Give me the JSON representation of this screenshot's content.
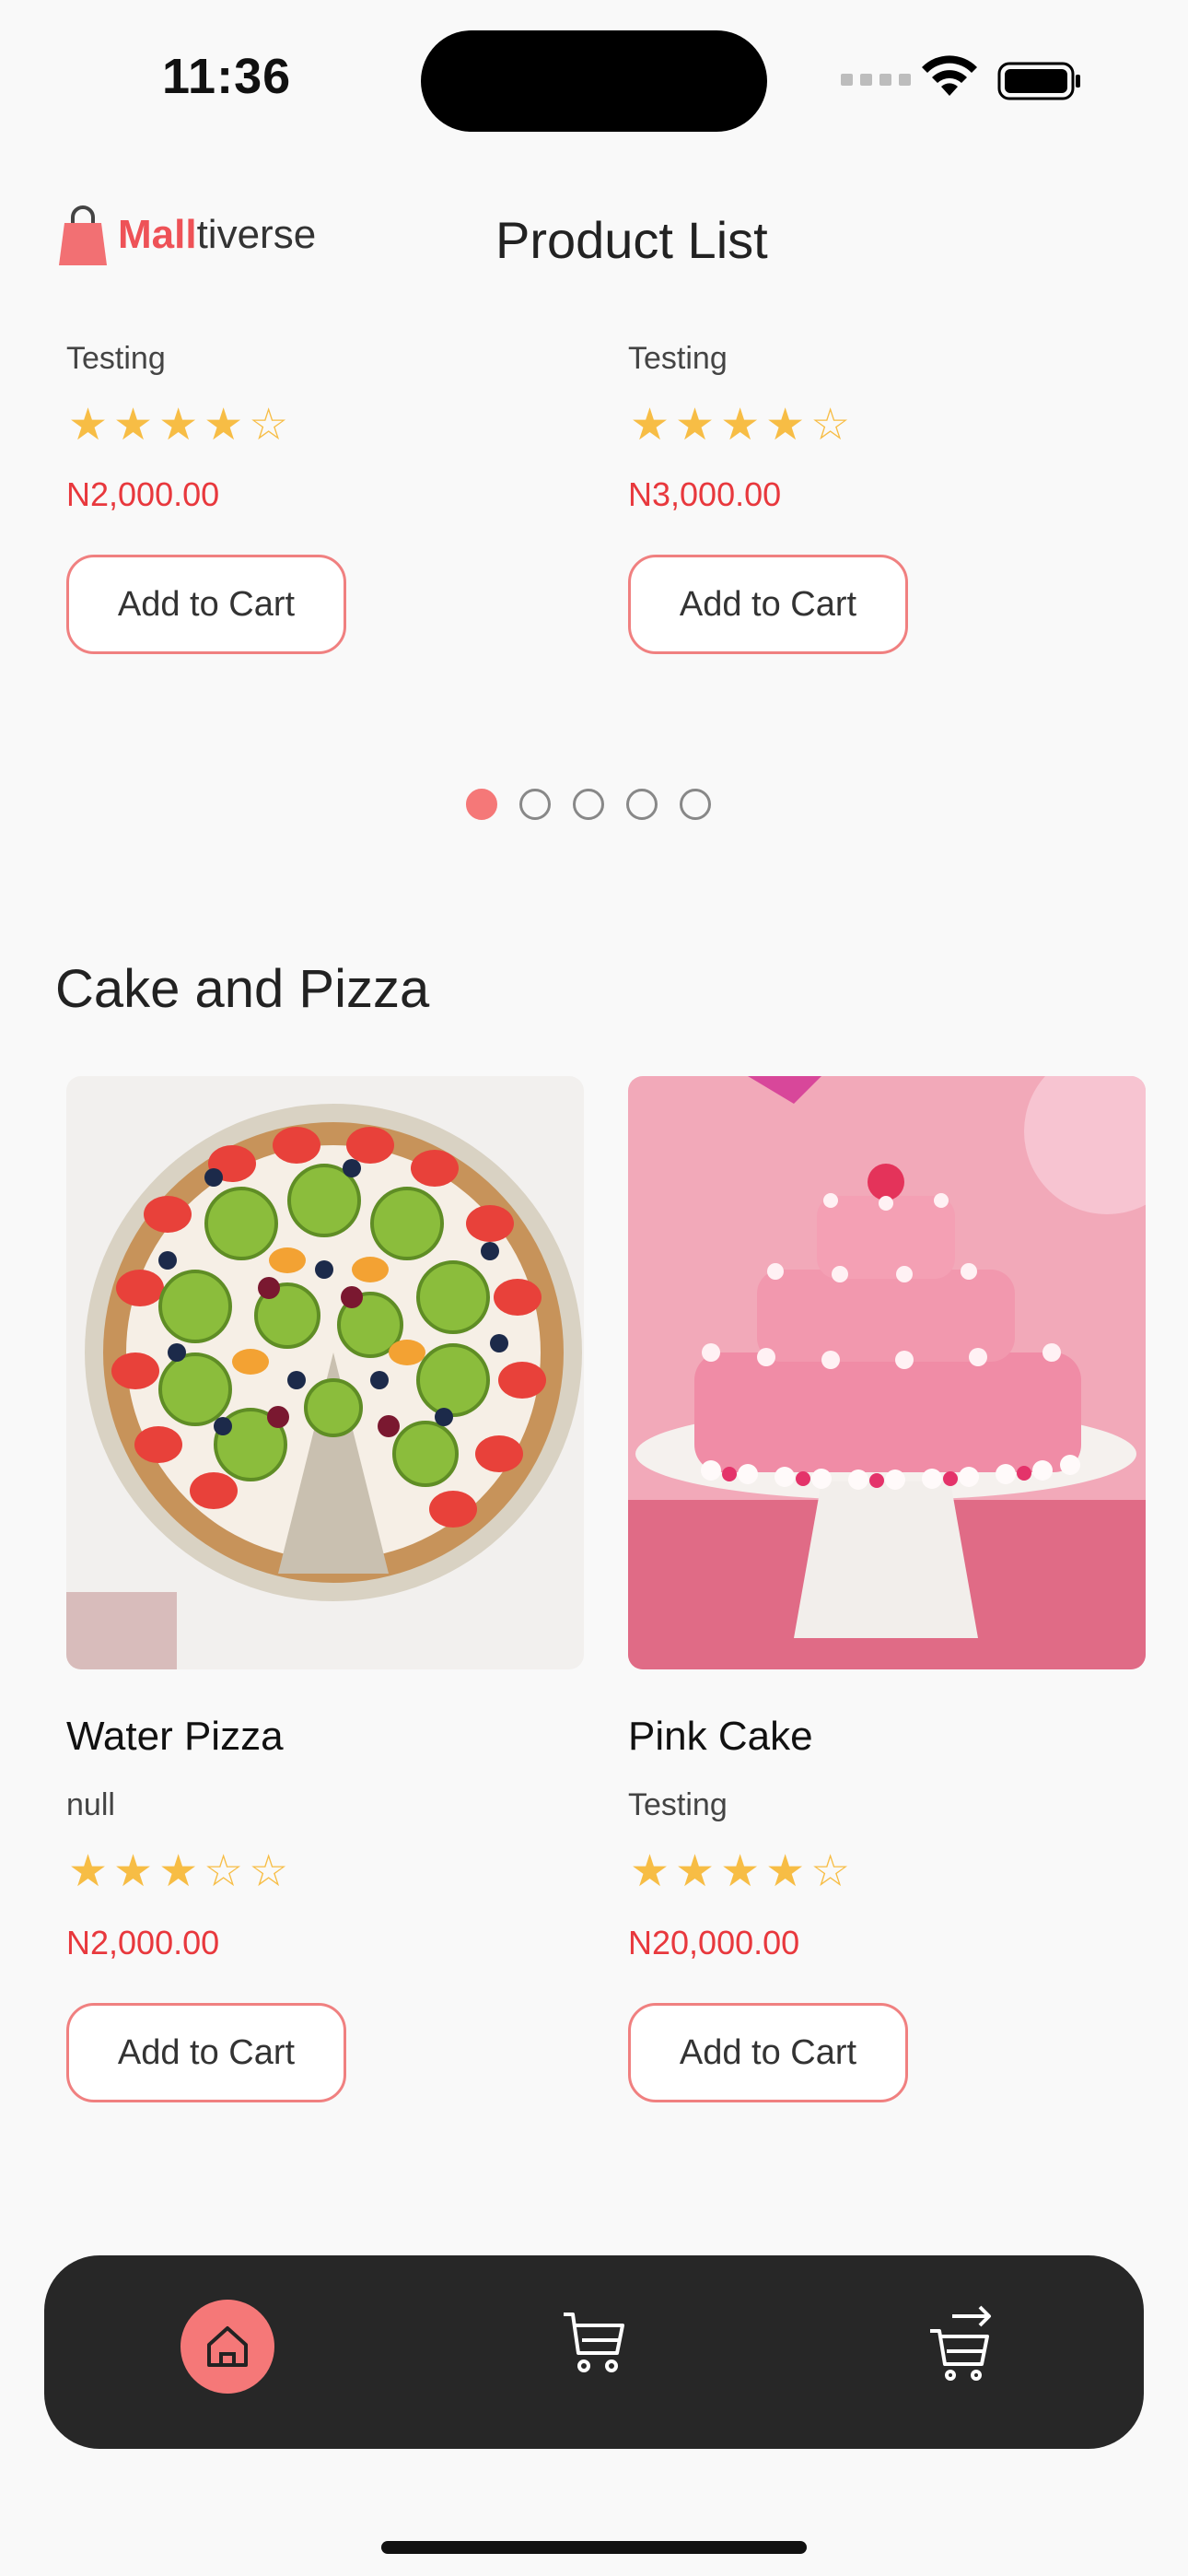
{
  "status_bar": {
    "time": "11:36"
  },
  "header": {
    "logo_text_a": "Mall",
    "logo_text_b": "tiverse",
    "title": "Product List"
  },
  "carousel_top": {
    "products": [
      {
        "description": "Testing",
        "rating": 4,
        "price": "N2,000.00",
        "button_label": "Add to Cart"
      },
      {
        "description": "Testing",
        "rating": 4,
        "price": "N3,000.00",
        "button_label": "Add to Cart"
      }
    ],
    "pages": 5,
    "active_page": 1
  },
  "section": {
    "title": "Cake and Pizza",
    "products": [
      {
        "name": "Water Pizza",
        "description": "null",
        "rating": 3,
        "price": "N2,000.00",
        "button_label": "Add to Cart",
        "image": "fruit-pizza-image"
      },
      {
        "name": "Pink Cake",
        "description": "Testing",
        "rating": 4,
        "price": "N20,000.00",
        "button_label": "Add to Cart",
        "image": "pink-cake-image"
      }
    ]
  },
  "bottom_nav": {
    "items": [
      {
        "icon": "home-icon",
        "active": true
      },
      {
        "icon": "cart-icon",
        "active": false
      },
      {
        "icon": "checkout-cart-icon",
        "active": false
      }
    ]
  },
  "colors": {
    "accent": "#f57878",
    "price": "#e8383d",
    "star": "#f7bd45",
    "nav_background": "#272727"
  }
}
